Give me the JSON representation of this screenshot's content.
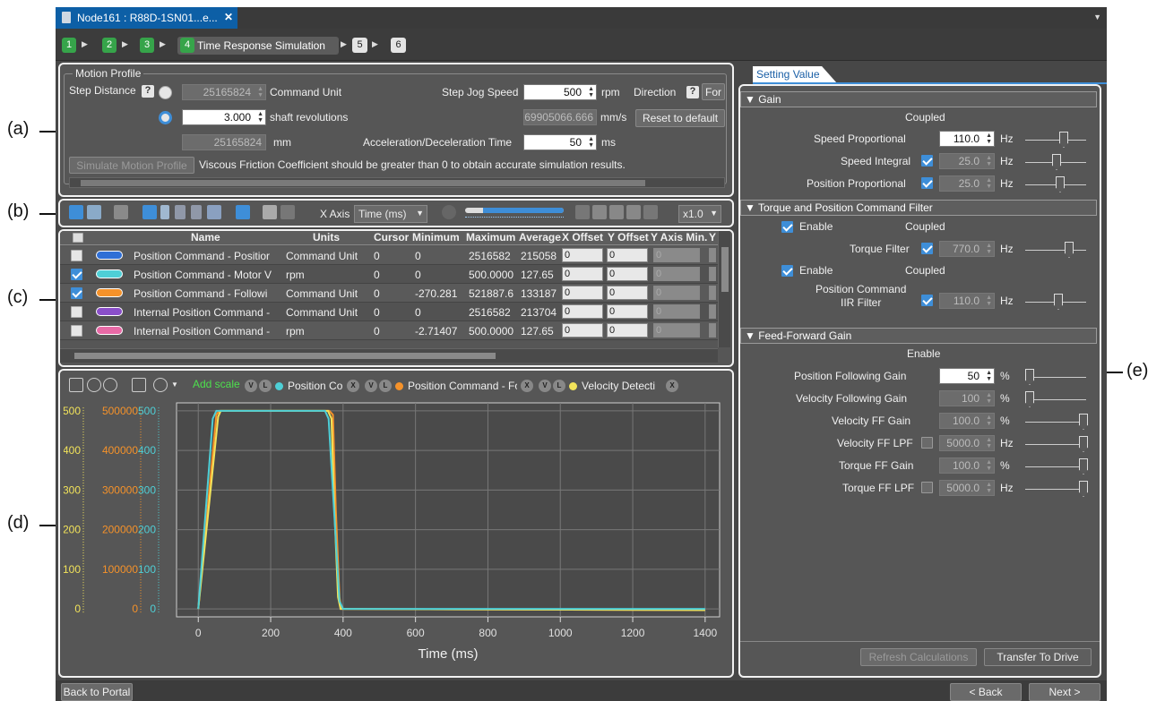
{
  "callouts": {
    "a": "(a)",
    "b": "(b)",
    "c": "(c)",
    "d": "(d)",
    "e": "(e)"
  },
  "tab": {
    "title": "Node161 : R88D-1SN01...e..."
  },
  "steps": [
    {
      "num": "1"
    },
    {
      "num": "2"
    },
    {
      "num": "3"
    },
    {
      "num": "4",
      "label": "Time Response Simulation"
    },
    {
      "num": "5"
    },
    {
      "num": "6"
    }
  ],
  "motion_profile": {
    "title": "Motion Profile",
    "step_distance_label": "Step Distance",
    "help": "?",
    "command_unit_value": "25165824",
    "command_unit_label": "Command Unit",
    "shaft_rev_value": "3.000",
    "shaft_rev_label": "shaft revolutions",
    "mm_value": "25165824",
    "mm_label": "mm",
    "step_jog_speed_label": "Step Jog Speed",
    "step_jog_speed_value": "500",
    "rpm": "rpm",
    "direction_label": "Direction",
    "direction_btn": "For",
    "mms_value": "69905066.666",
    "mms_label": "mm/s",
    "reset_btn": "Reset to default",
    "accel_label": "Acceleration/Deceleration Time",
    "accel_value": "50",
    "ms": "ms",
    "simulate_btn": "Simulate Motion Profile",
    "viscous_msg": "Viscous Friction Coefficient should be greater than 0 to obtain accurate simulation results."
  },
  "toolbar": {
    "xaxis_label": "X Axis",
    "xaxis_value": "Time (ms)",
    "speed": "x1.0"
  },
  "table": {
    "headers": [
      "Name",
      "Units",
      "Cursor",
      "Minimum",
      "Maximum",
      "Average",
      "X Offset",
      "Y Offset",
      "Y Axis Min.",
      "Y"
    ],
    "rows": [
      {
        "checked": false,
        "color": "#2f6fd6",
        "name": "Position Command - Positior",
        "units": "Command Unit",
        "cursor": "0",
        "min": "0",
        "max": "2516582",
        "avg": "215058",
        "xoff": "0",
        "yoff": "0",
        "ymin": "0"
      },
      {
        "checked": true,
        "color": "#4ecfd6",
        "name": "Position Command - Motor V",
        "units": "rpm",
        "cursor": "0",
        "min": "0",
        "max": "500.0000",
        "avg": "127.65",
        "xoff": "0",
        "yoff": "0",
        "ymin": "0"
      },
      {
        "checked": true,
        "color": "#f5922a",
        "name": "Position Command - Followi",
        "units": "Command Unit",
        "cursor": "0",
        "min": "-270.281",
        "max": "521887.6",
        "avg": "133187",
        "xoff": "0",
        "yoff": "0",
        "ymin": "0"
      },
      {
        "checked": false,
        "color": "#8a4fc9",
        "name": "Internal Position Command -",
        "units": "Command Unit",
        "cursor": "0",
        "min": "0",
        "max": "2516582",
        "avg": "213704",
        "xoff": "0",
        "yoff": "0",
        "ymin": "0"
      },
      {
        "checked": false,
        "color": "#e86aa6",
        "name": "Internal Position Command -",
        "units": "rpm",
        "cursor": "0",
        "min": "-2.71407",
        "max": "500.0000",
        "avg": "127.65",
        "xoff": "0",
        "yoff": "0",
        "ymin": "0"
      }
    ]
  },
  "graph_toolbar": {
    "add_scale": "Add scale",
    "chips": [
      {
        "v": "V",
        "l": "L",
        "dot": "#4ecfd6",
        "label": "Position Cor",
        "x": "X"
      },
      {
        "v": "V",
        "l": "L",
        "dot": "#f5922a",
        "label": "Position Command - Follov",
        "x": "X"
      },
      {
        "v": "V",
        "l": "L",
        "dot": "#f2e35a",
        "label": "Velocity Detecti",
        "x": "X"
      }
    ]
  },
  "chart_data": {
    "type": "line",
    "xlabel": "Time (ms)",
    "xlim": [
      -60,
      1440
    ],
    "xticks": [
      0,
      200,
      400,
      600,
      800,
      1000,
      1200,
      1400
    ],
    "y_axes": [
      {
        "color": "#f2e35a",
        "ticks": [
          "0",
          "100",
          "200",
          "300",
          "400",
          "500"
        ]
      },
      {
        "color": "#f5922a",
        "ticks": [
          "0",
          "100000",
          "200000",
          "300000",
          "400000",
          "500000"
        ]
      },
      {
        "color": "#4ecfd6",
        "ticks": [
          "0",
          "100",
          "200",
          "300",
          "400",
          "500"
        ]
      }
    ],
    "ylim": [
      -20,
      520
    ],
    "series": [
      {
        "color": "#f5922a",
        "x": [
          0,
          50,
          58,
          362,
          372,
          380,
          390,
          395,
          1400
        ],
        "y": [
          0,
          490,
          500,
          500,
          490,
          250,
          30,
          0,
          -3
        ]
      },
      {
        "color": "#f2e35a",
        "x": [
          0,
          55,
          62,
          358,
          368,
          376,
          386,
          393,
          1400
        ],
        "y": [
          0,
          485,
          500,
          500,
          480,
          250,
          30,
          0,
          -3
        ]
      },
      {
        "color": "#4ecfd6",
        "x": [
          0,
          40,
          50,
          350,
          360,
          390,
          400,
          1400
        ],
        "y": [
          0,
          480,
          500,
          500,
          480,
          20,
          0,
          0
        ]
      }
    ]
  },
  "setting": {
    "tab": "Setting Value",
    "gain": {
      "title": "▼ Gain",
      "coupled": "Coupled",
      "speed_prop_label": "Speed Proportional",
      "speed_prop_value": "110.0",
      "speed_int_label": "Speed Integral",
      "speed_int_value": "25.0",
      "pos_prop_label": "Position Proportional",
      "pos_prop_value": "25.0",
      "hz": "Hz"
    },
    "torque": {
      "title": "▼ Torque and Position Command Filter",
      "enable1": "Enable",
      "coupled1": "Coupled",
      "filter_label": "Torque Filter",
      "filter_value": "770.0",
      "enable2": "Enable",
      "coupled2": "Coupled",
      "iir_label1": "Position Command",
      "iir_label2": "IIR Filter",
      "iir_value": "110.0"
    },
    "ff": {
      "title": "▼ Feed-Forward Gain",
      "enable": "Enable",
      "pos_follow_label": "Position Following Gain",
      "pos_follow_value": "50",
      "vel_follow_label": "Velocity Following Gain",
      "vel_follow_value": "100",
      "vel_ff_label": "Velocity FF Gain",
      "vel_ff_value": "100.0",
      "vel_lpf_label": "Velocity FF LPF",
      "vel_lpf_value": "5000.0",
      "tq_ff_label": "Torque FF Gain",
      "tq_ff_value": "100.0",
      "tq_lpf_label": "Torque FF LPF",
      "tq_lpf_value": "5000.0",
      "pct": "%"
    },
    "refresh_btn": "Refresh Calculations",
    "transfer_btn": "Transfer To Drive"
  },
  "footer": {
    "back_portal": "Back to Portal",
    "back": "< Back",
    "next": "Next >"
  }
}
